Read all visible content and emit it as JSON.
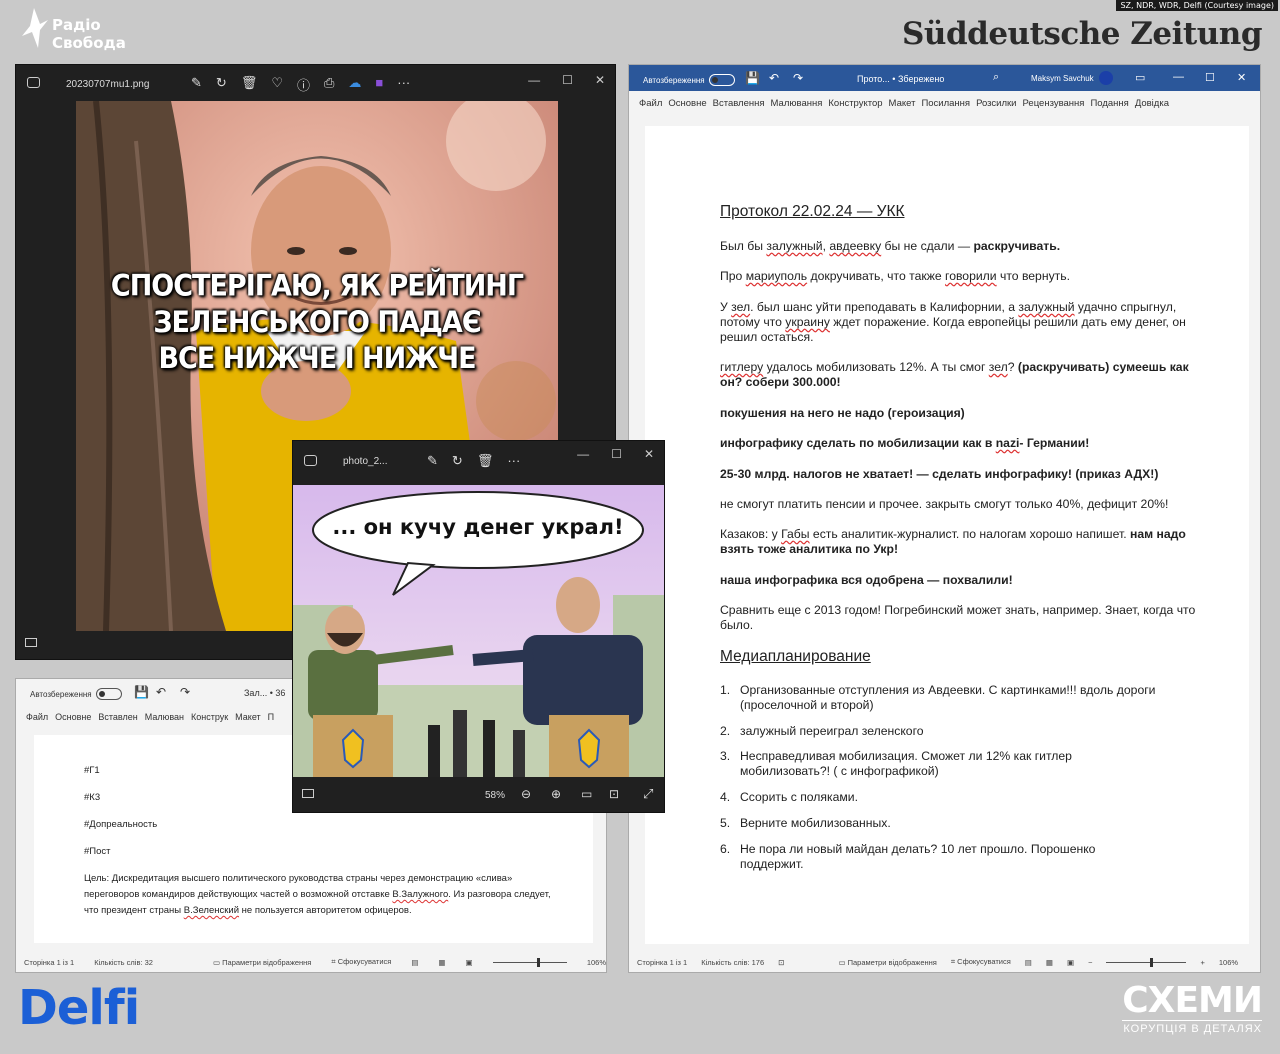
{
  "credit": "SZ, NDR, WDR, Delfi (Courtesy image)",
  "logos": {
    "radio_svoboda_line1": "Радіо",
    "radio_svoboda_line2": "Свобода",
    "sz": "Süddeutsche Zeitung",
    "delfi": "Delfi",
    "schemy": "СХЕМИ",
    "schemy_sub": "КОРУПЦІЯ В ДЕТАЛЯХ"
  },
  "viewer1": {
    "filename": "20230707mu1.png",
    "meme_line1": "СПОСТЕРІГАЮ, ЯК РЕЙТИНГ",
    "meme_line2": "ЗЕЛЕНСЬКОГО ПАДАЄ",
    "meme_line3": "ВСЕ НИЖЧЕ І НИЖЧЕ"
  },
  "viewer2": {
    "filename": "photo_2...",
    "bubble": "... он кучу денег украл!",
    "zoom": "58%"
  },
  "word1": {
    "autosave": "Автозбереження",
    "title": "Зал... • 36",
    "ribbon": [
      "Файл",
      "Основне",
      "Вставлен",
      "Малюван",
      "Конструк",
      "Макет",
      "П"
    ],
    "lines": [
      "#Г1",
      "#К3",
      "#Допреальность",
      "#Пост"
    ],
    "goal_prefix": "Цель: Дискредитация высшего политического руководства страны через демонстрацию «слива» переговоров командиров действующих частей о возможной отставке ",
    "goal_name1": "В.Залужного",
    "goal_mid": ". Из разговора следует, что президент страны ",
    "goal_name2": "В.Зеленский",
    "goal_end": " не пользуется авторитетом офицеров.",
    "status_page": "Сторінка 1 із 1",
    "status_words": "Кількість слів: 32",
    "status_params": "Параметри відображення",
    "status_focus": "Сфокусуватися",
    "status_zoom": "106%"
  },
  "word2": {
    "autosave": "Автозбереження",
    "title": "Прото... • Збережено",
    "user": "Maksym Savchuk",
    "ribbon": [
      "Файл",
      "Основне",
      "Вставлення",
      "Малювання",
      "Конструктор",
      "Макет",
      "Посилання",
      "Розсилки",
      "Рецензування",
      "Подання",
      "Довідка"
    ],
    "heading": "Протокол 22.02.24 — УКК",
    "p1_a": "Был бы ",
    "p1_u1": "залужный",
    "p1_b": ", ",
    "p1_u2": "авдеевку",
    "p1_c": " бы не сдали — ",
    "p1_bold": "раскручивать.",
    "p2_a": "Про ",
    "p2_u1": "мариуполь",
    "p2_b": " докручивать, что также ",
    "p2_u2": "говорили",
    "p2_c": " что вернуть.",
    "p3_a": "У ",
    "p3_u1": "зел",
    "p3_b": ". был шанс уйти преподавать в Калифорнии, а ",
    "p3_u2": "залужный",
    "p3_c": " удачно спрыгнул, потому что ",
    "p3_u3": "украину",
    "p3_d": " ждет поражение. Когда европейцы решили дать ему денег, он решил остаться.",
    "p4_u1": "гитлеру",
    "p4_a": " удалось мобилизовать 12%. А ты смог ",
    "p4_u2": "зел",
    "p4_b": "? ",
    "p4_bold": "(раскручивать) сумеешь как он? собери 300.000!",
    "p5": "покушения на него не надо (героизация)",
    "p6_a": "инфографику сделать по мобилизации как в ",
    "p6_u": "nazi",
    "p6_b": "- Германии!",
    "p7": "25-30 млрд. налогов не хватает! — сделать инфографику! (приказ АДХ!)",
    "p8": "не смогут платить пенсии и прочее. закрыть смогут только 40%, дефицит 20%!",
    "p9_a": "Казаков: у ",
    "p9_u": "Габы",
    "p9_b": " есть аналитик-журналист. по налогам хорошо напишет. ",
    "p9_bold": "нам надо взять тоже аналитика по Укр!",
    "p10": "наша инфографика вся одобрена — похвалили!",
    "p11": "Сравнить еще с 2013 годом! Погребинский может знать, например. Знает, когда что было.",
    "heading2": "Медиапланирование",
    "items": [
      {
        "num": "1.",
        "text": "Организованные отступления из Авдеевки. С картинками!!! вдоль дороги (проселочной и второй)"
      },
      {
        "num": "2.",
        "text": "залужный переиграл зеленского"
      },
      {
        "num": "3.",
        "text": "Несправедливая мобилизация. Сможет ли 12% как гитлер мобилизовать?! ( с инфографикой)"
      },
      {
        "num": "4.",
        "text": "Ссорить с поляками."
      },
      {
        "num": "5.",
        "text": "Верните мобилизованных."
      },
      {
        "num": "6.",
        "text": "Не пора ли новый майдан делать? 10 лет прошло. Порошенко поддержит."
      }
    ],
    "status_page": "Сторінка 1 із 1",
    "status_words": "Кількість слів: 176",
    "status_params": "Параметри відображення",
    "status_focus": "Сфокусуватися",
    "status_zoom": "106%"
  }
}
